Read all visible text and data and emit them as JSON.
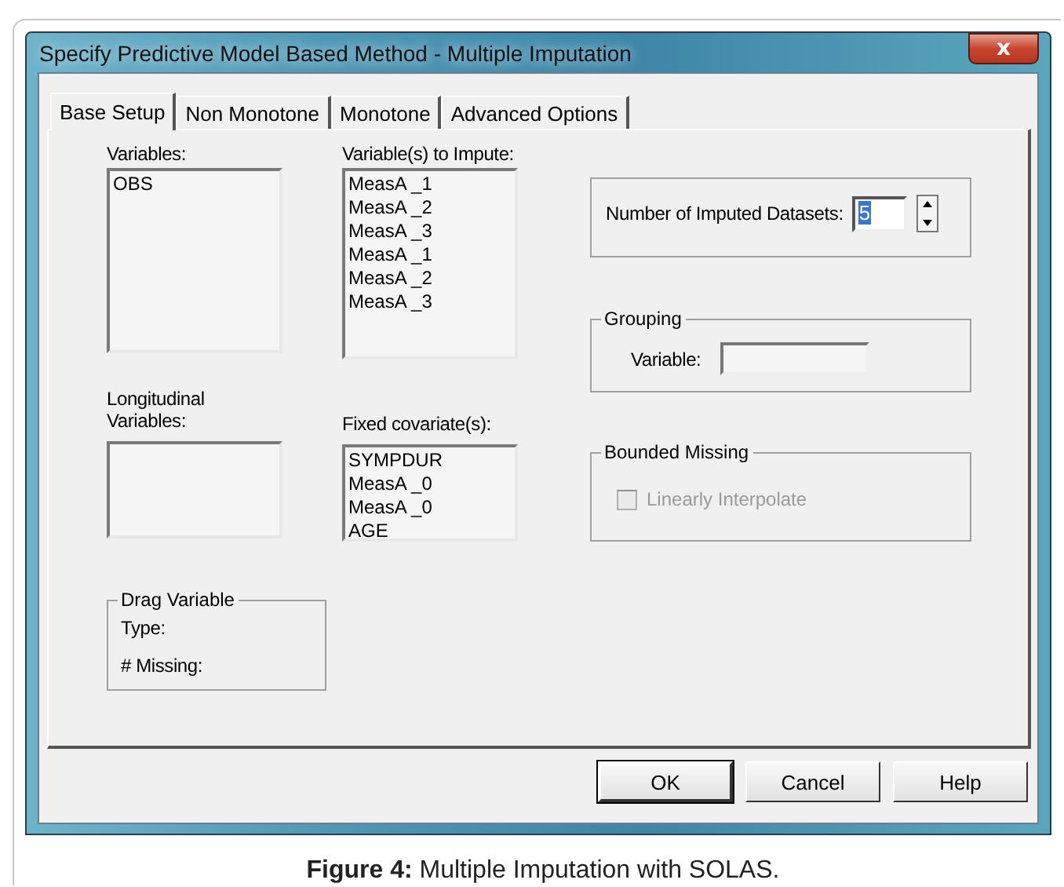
{
  "window": {
    "title": "Specify Predictive Model Based Method - Multiple Imputation",
    "close_glyph": "x"
  },
  "tabs": [
    {
      "label": "Base Setup",
      "selected": true
    },
    {
      "label": "Non Monotone",
      "selected": false
    },
    {
      "label": "Monotone",
      "selected": false
    },
    {
      "label": "Advanced Options",
      "selected": false
    }
  ],
  "variables": {
    "label": "Variables:",
    "items": [
      "OBS"
    ]
  },
  "longitudinal": {
    "label": "Longitudinal Variables:"
  },
  "drag_variable": {
    "title": "Drag Variable",
    "type_label": "Type:",
    "missing_label": "# Missing:"
  },
  "to_impute": {
    "label": "Variable(s) to Impute:",
    "items": [
      "MeasA _1",
      "MeasA _2",
      "MeasA _3",
      "MeasA _1",
      "MeasA _2",
      "MeasA _3"
    ]
  },
  "fixed_covariates": {
    "label": "Fixed covariate(s):",
    "items": [
      "SYMPDUR",
      "MeasA _0",
      "MeasA _0",
      "AGE"
    ]
  },
  "imputed_datasets": {
    "label": "Number of Imputed Datasets:",
    "value": "5",
    "value_selected": true
  },
  "grouping": {
    "title": "Grouping",
    "variable_label": "Variable:"
  },
  "bounded_missing": {
    "title": "Bounded Missing",
    "checkbox": {
      "label": "Linearly Interpolate",
      "checked": false,
      "disabled": true
    }
  },
  "buttons": [
    {
      "label": "OK",
      "default": true
    },
    {
      "label": "Cancel",
      "default": false
    },
    {
      "label": "Help",
      "default": false
    }
  ],
  "caption": "**Figure 4:** Multiple Imputation with SOLAS."
}
